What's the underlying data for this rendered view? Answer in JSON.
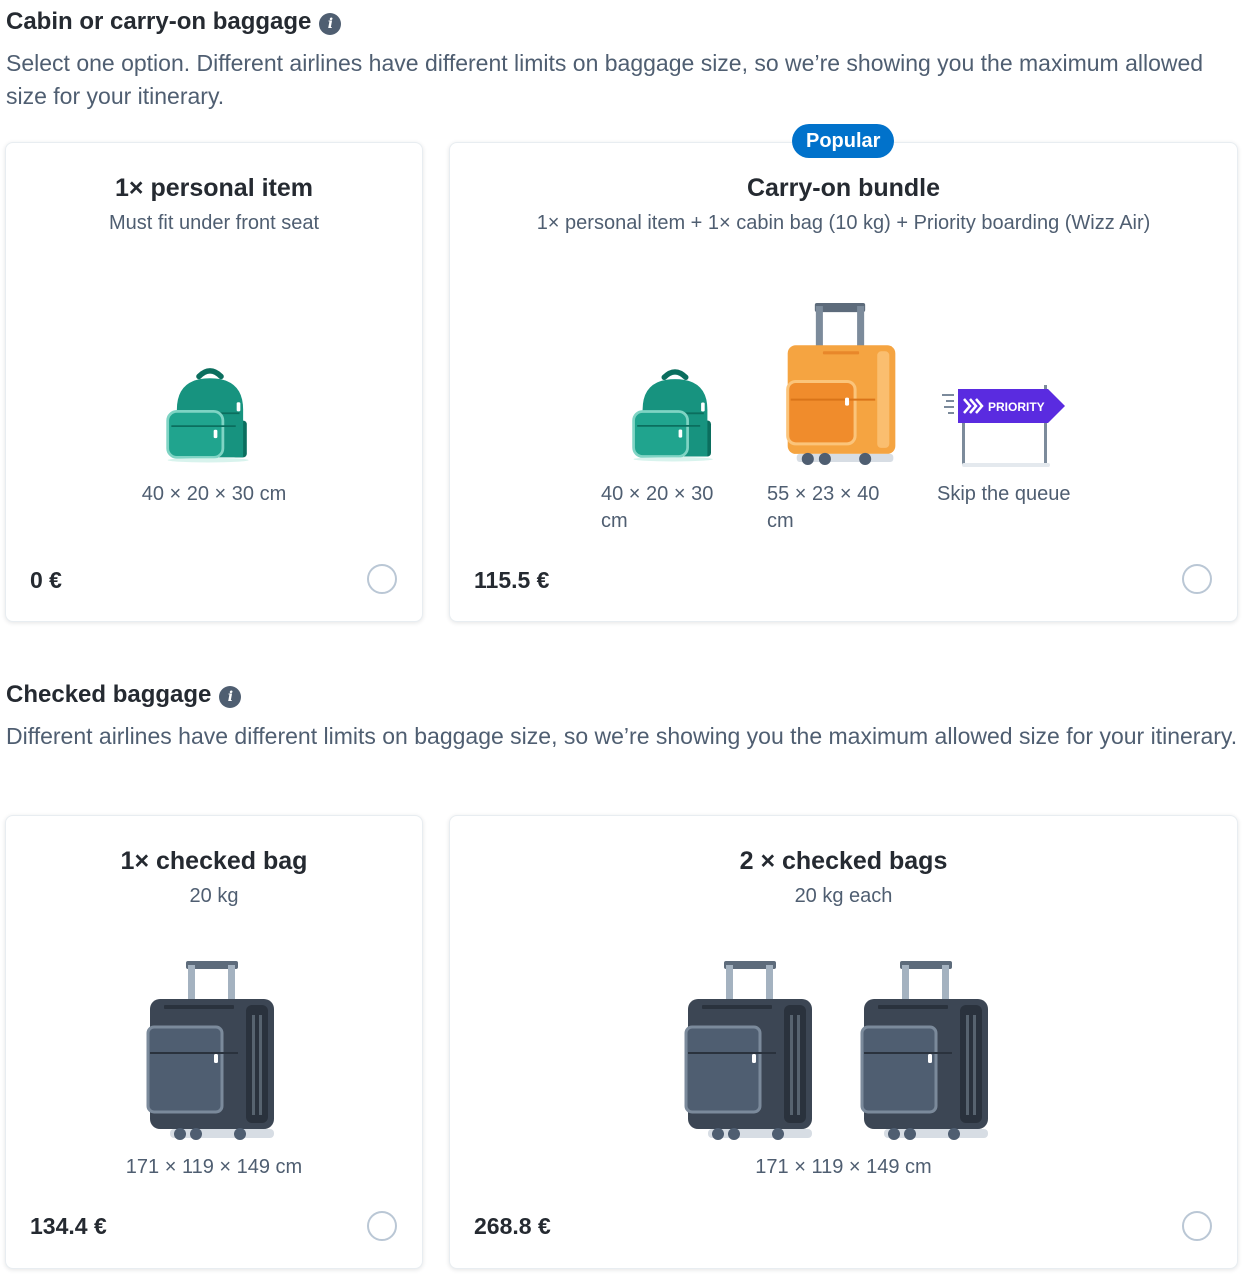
{
  "cabin": {
    "title": "Cabin or carry-on baggage",
    "info_icon": "info-icon",
    "description": "Select one option. Different airlines have different limits on baggage size, so we’re showing you the maximum allowed size for your itinerary.",
    "options": [
      {
        "title": "1× personal item",
        "subtitle": "Must fit under front seat",
        "items": [
          {
            "icon": "backpack-icon",
            "label": "40 × 20 × 30 cm"
          }
        ],
        "price": "0 €",
        "selected": false
      },
      {
        "badge": "Popular",
        "title": "Carry-on bundle",
        "subtitle": "1× personal item + 1× cabin bag (10 kg) + Priority boarding (Wizz Air)",
        "items": [
          {
            "icon": "backpack-icon",
            "label": "40 × 20 × 30 cm"
          },
          {
            "icon": "cabin-suitcase-icon",
            "label": "55 × 23 × 40 cm"
          },
          {
            "icon": "priority-sign-icon",
            "label": "Skip the queue",
            "sign_text": "PRIORITY"
          }
        ],
        "price": "115.5 €",
        "selected": false
      }
    ]
  },
  "checked": {
    "title": "Checked baggage",
    "info_icon": "info-icon",
    "description": "Different airlines have different limits on baggage size, so we’re showing you the maximum allowed size for your itinerary.",
    "options": [
      {
        "title": "1× checked bag",
        "subtitle": "20 kg",
        "items": [
          {
            "icon": "checked-suitcase-icon",
            "label": "171 × 119 × 149 cm"
          }
        ],
        "price": "134.4 €",
        "selected": false
      },
      {
        "title": "2 × checked bags",
        "subtitle": "20 kg each",
        "items": [
          {
            "icon": "checked-suitcase-icon",
            "label": "171 × 119 × 149 cm"
          }
        ],
        "price": "268.8 €",
        "selected": false
      }
    ]
  },
  "colors": {
    "text_primary": "#252a31",
    "text_secondary": "#4f5e71",
    "badge_blue": "#0172cb",
    "backpack_green": "#17937f",
    "suitcase_orange": "#f5a441",
    "suitcase_dark": "#3c4654",
    "priority_purple": "#5a2be0"
  }
}
